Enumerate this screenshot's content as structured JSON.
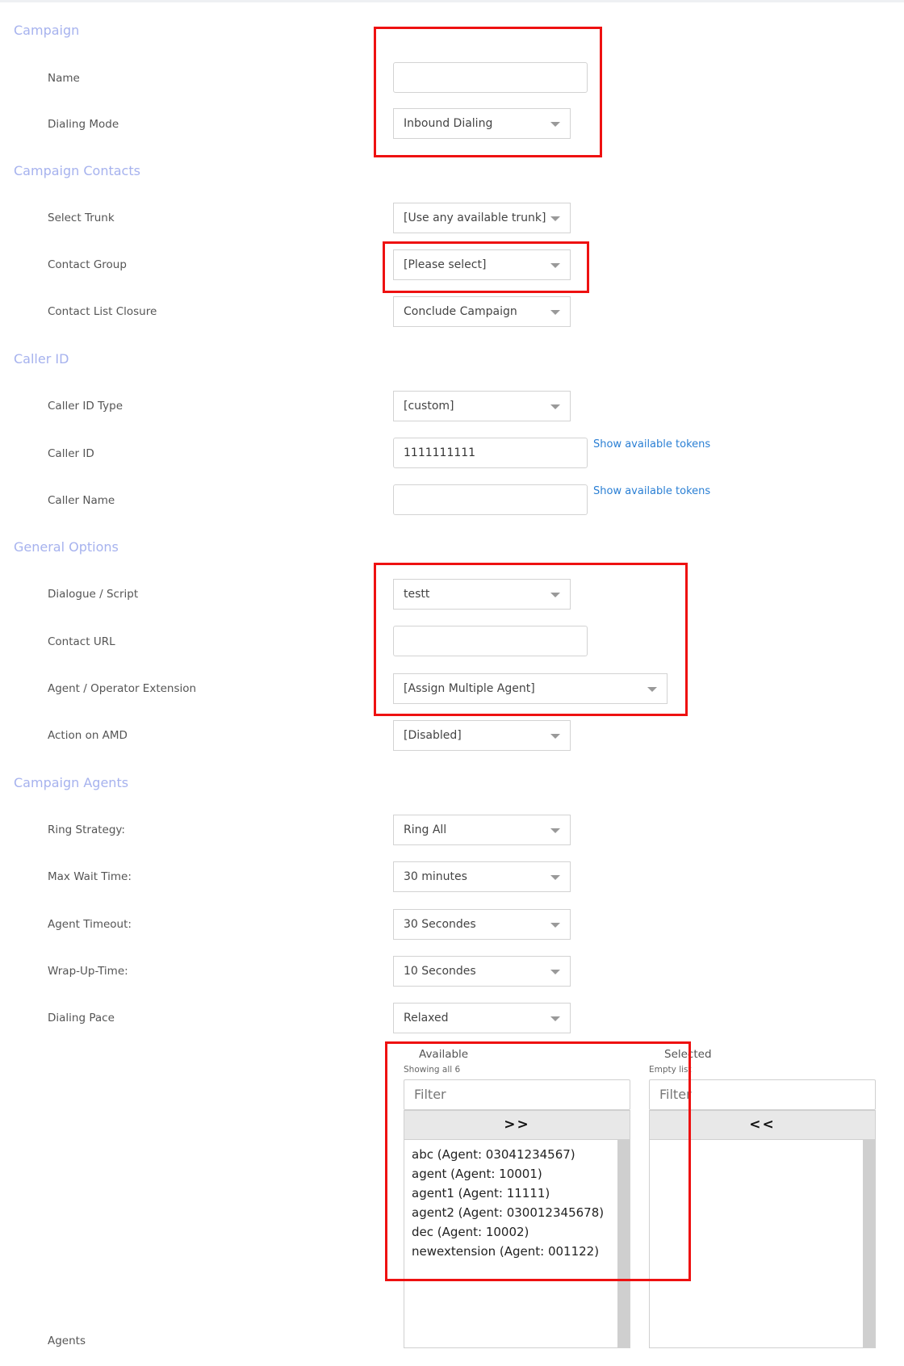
{
  "sections": {
    "campaign": "Campaign",
    "contacts": "Campaign Contacts",
    "caller_id": "Caller ID",
    "general": "General Options",
    "agents": "Campaign Agents"
  },
  "fields": {
    "name": {
      "label": "Name",
      "value": ""
    },
    "dialing_mode": {
      "label": "Dialing Mode",
      "value": "Inbound Dialing"
    },
    "select_trunk": {
      "label": "Select Trunk",
      "value": "[Use any available trunk]"
    },
    "contact_group": {
      "label": "Contact Group",
      "value": "[Please select]"
    },
    "contact_list_closure": {
      "label": "Contact List Closure",
      "value": "Conclude Campaign"
    },
    "caller_id_type": {
      "label": "Caller ID Type",
      "value": "[custom]"
    },
    "caller_id": {
      "label": "Caller ID",
      "value": "1111111111"
    },
    "caller_name": {
      "label": "Caller Name",
      "value": ""
    },
    "dialogue_script": {
      "label": "Dialogue / Script",
      "value": "testt"
    },
    "contact_url": {
      "label": "Contact URL",
      "value": ""
    },
    "agent_extension": {
      "label": "Agent / Operator Extension",
      "value": "[Assign Multiple Agent]"
    },
    "action_on_amd": {
      "label": "Action on AMD",
      "value": "[Disabled]"
    },
    "ring_strategy": {
      "label": "Ring Strategy:",
      "value": "Ring All"
    },
    "max_wait_time": {
      "label": "Max Wait Time:",
      "value": "30 minutes"
    },
    "agent_timeout": {
      "label": "Agent Timeout:",
      "value": "30 Secondes"
    },
    "wrap_up_time": {
      "label": "Wrap-Up-Time:",
      "value": "10 Secondes"
    },
    "dialing_pace": {
      "label": "Dialing Pace",
      "value": "Relaxed"
    },
    "agents": {
      "label": "Agents"
    }
  },
  "token_link": "Show available tokens",
  "dual_list": {
    "available": {
      "title": "Available",
      "info": "Showing all 6",
      "filter_placeholder": "Filter",
      "move_label": ">>",
      "options": [
        "abc (Agent: 03041234567)",
        "agent (Agent: 10001)",
        "agent1 (Agent: 11111)",
        "agent2 (Agent: 030012345678)",
        "dec (Agent: 10002)",
        "newextension (Agent: 001122)"
      ]
    },
    "selected": {
      "title": "Selected",
      "info": "Empty list",
      "filter_placeholder": "Filter",
      "move_label": "<<",
      "options": []
    }
  },
  "annotation_color": "#ee1111",
  "section_color": "#a6b2ee",
  "link_color": "#2a7fd4"
}
